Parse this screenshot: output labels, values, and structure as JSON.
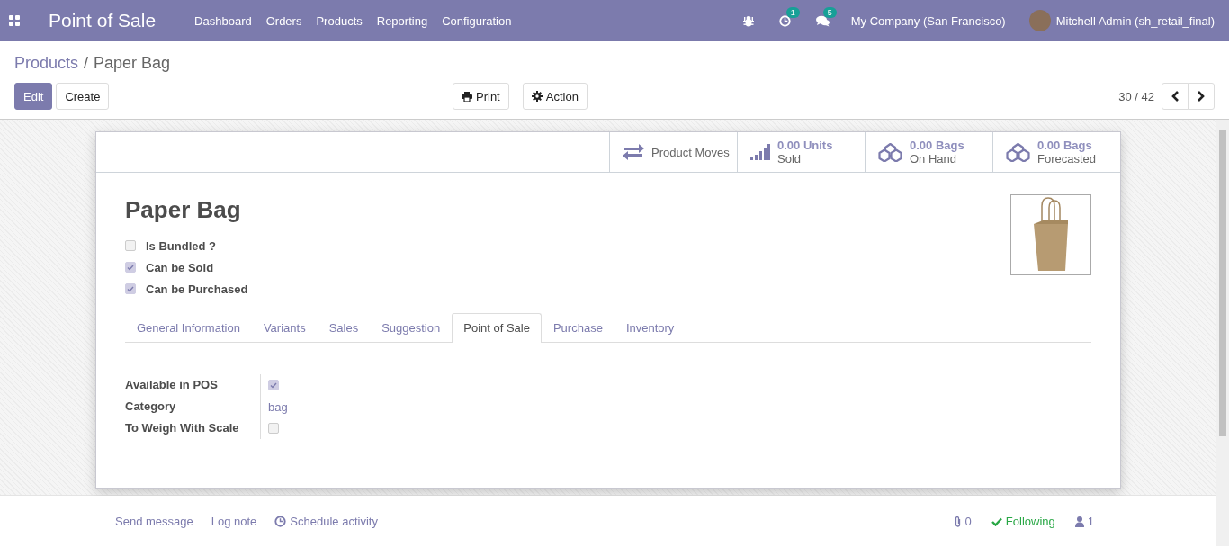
{
  "app_title": "Point of Sale",
  "menu": [
    "Dashboard",
    "Orders",
    "Products",
    "Reporting",
    "Configuration"
  ],
  "systray": {
    "activity_count": "1",
    "message_count": "5",
    "company": "My Company (San Francisco)",
    "user": "Mitchell Admin (sh_retail_final)"
  },
  "breadcrumb": [
    "Products",
    "/",
    "Paper Bag"
  ],
  "buttons": {
    "edit": "Edit",
    "create": "Create",
    "print": "Print",
    "action": "Action"
  },
  "pager": "30 / 42",
  "smart_buttons": [
    {
      "kind": "moves",
      "label": "Product Moves"
    },
    {
      "kind": "sold",
      "value": "0.00 Units",
      "label": "Sold"
    },
    {
      "kind": "stock",
      "value": "0.00 Bags",
      "label": "On Hand"
    },
    {
      "kind": "stock",
      "value": "0.00 Bags",
      "label": "Forecasted"
    }
  ],
  "product": {
    "name": "Paper Bag",
    "flags": [
      {
        "label": "Is Bundled ?",
        "checked": false
      },
      {
        "label": "Can be Sold",
        "checked": true
      },
      {
        "label": "Can be Purchased",
        "checked": true
      }
    ]
  },
  "tabs": [
    {
      "label": "General Information",
      "selected": false
    },
    {
      "label": "Variants",
      "selected": false
    },
    {
      "label": "Sales",
      "selected": false
    },
    {
      "label": "Suggestion",
      "selected": false
    },
    {
      "label": "Point of Sale",
      "selected": true
    },
    {
      "label": "Purchase",
      "selected": false
    },
    {
      "label": "Inventory",
      "selected": false
    }
  ],
  "fields": [
    {
      "kind": "checkbox",
      "label": "Available in POS",
      "checked": true
    },
    {
      "kind": "link",
      "label": "Category",
      "value": "bag"
    },
    {
      "kind": "checkbox",
      "label": "To Weigh With Scale",
      "checked": false
    }
  ],
  "chatter": {
    "actions": [
      "Send message",
      "Log note",
      "Schedule activity"
    ],
    "attachments": "0",
    "following": "Following",
    "followers": "1"
  }
}
